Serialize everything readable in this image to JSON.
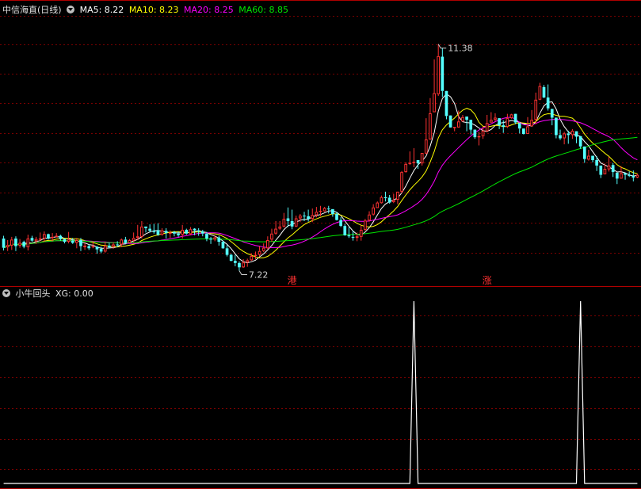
{
  "header_main": {
    "title": "中信海直(日线)",
    "ma5": "MA5: 8.22",
    "ma10": "MA10: 8.23",
    "ma20": "MA20: 8.25",
    "ma60": "MA60: 8.85"
  },
  "header_ind": {
    "title": "小牛回头",
    "xg": "XG: 0.00"
  },
  "colors": {
    "up": "#ff3232",
    "down": "#54ffff",
    "ma5": "#ffffff",
    "ma10": "#ffff00",
    "ma20": "#ff00ff",
    "ma60": "#00e600",
    "grid": "#7a0000",
    "marker_text": "#ff3232",
    "xg_line": "#ffffff"
  },
  "chart_data": [
    {
      "type": "candlestick",
      "ylim": [
        6.95,
        11.9
      ],
      "annotations": {
        "high_label": "11.38",
        "low_label": "7.22"
      },
      "markers": [
        {
          "index": 71,
          "label": "港"
        },
        {
          "index": 119,
          "label": "涨"
        },
        {
          "index": 159,
          "label": "$"
        }
      ],
      "series_names": [
        "MA5",
        "MA10",
        "MA20",
        "MA60"
      ],
      "candles": [
        [
          7.81,
          7.64,
          7.86,
          7.59
        ],
        [
          7.65,
          7.69,
          7.78,
          7.58
        ],
        [
          7.68,
          7.79,
          7.84,
          7.6
        ],
        [
          7.81,
          7.67,
          7.85,
          7.58
        ],
        [
          7.68,
          7.73,
          7.8,
          7.64
        ],
        [
          7.75,
          7.66,
          7.77,
          7.63
        ],
        [
          7.65,
          7.81,
          7.88,
          7.59
        ],
        [
          7.82,
          7.77,
          7.86,
          7.75
        ],
        [
          7.76,
          7.8,
          7.84,
          7.71
        ],
        [
          7.81,
          7.81,
          7.92,
          7.76
        ],
        [
          7.81,
          7.89,
          7.94,
          7.75
        ],
        [
          7.89,
          7.81,
          7.9,
          7.79
        ],
        [
          7.82,
          7.84,
          7.91,
          7.76
        ],
        [
          7.85,
          7.86,
          7.91,
          7.83
        ],
        [
          7.86,
          7.8,
          7.88,
          7.77
        ],
        [
          7.8,
          7.75,
          7.81,
          7.72
        ],
        [
          7.75,
          7.79,
          7.93,
          7.72
        ],
        [
          7.77,
          7.73,
          7.82,
          7.71
        ],
        [
          7.73,
          7.78,
          7.82,
          7.63
        ],
        [
          7.78,
          7.67,
          7.82,
          7.58
        ],
        [
          7.65,
          7.68,
          7.73,
          7.6
        ],
        [
          7.67,
          7.63,
          7.7,
          7.6
        ],
        [
          7.65,
          7.67,
          7.76,
          7.63
        ],
        [
          7.66,
          7.61,
          7.67,
          7.53
        ],
        [
          7.62,
          7.57,
          7.66,
          7.54
        ],
        [
          7.57,
          7.68,
          7.75,
          7.55
        ],
        [
          7.68,
          7.65,
          7.73,
          7.63
        ],
        [
          7.66,
          7.7,
          7.74,
          7.62
        ],
        [
          7.7,
          7.69,
          7.76,
          7.65
        ],
        [
          7.7,
          7.79,
          7.81,
          7.65
        ],
        [
          7.79,
          7.73,
          7.84,
          7.71
        ],
        [
          7.73,
          7.78,
          7.8,
          7.73
        ],
        [
          7.77,
          7.82,
          7.92,
          7.74
        ],
        [
          7.82,
          7.85,
          8.06,
          7.78
        ],
        [
          7.84,
          8.03,
          8.13,
          7.81
        ],
        [
          8.03,
          8.0,
          8.03,
          7.92
        ],
        [
          7.99,
          7.95,
          8.07,
          7.92
        ],
        [
          7.95,
          7.93,
          8.08,
          7.9
        ],
        [
          7.96,
          7.88,
          8.09,
          7.86
        ],
        [
          7.88,
          7.96,
          8.0,
          7.86
        ],
        [
          7.95,
          7.91,
          8.0,
          7.81
        ],
        [
          7.91,
          7.92,
          7.96,
          7.82
        ],
        [
          7.93,
          7.9,
          7.95,
          7.85
        ],
        [
          7.9,
          7.87,
          7.94,
          7.84
        ],
        [
          7.88,
          7.97,
          8.06,
          7.81
        ],
        [
          7.97,
          7.9,
          7.99,
          7.88
        ],
        [
          7.89,
          7.98,
          8.02,
          7.87
        ],
        [
          7.99,
          7.96,
          8.0,
          7.87
        ],
        [
          7.96,
          7.94,
          8.0,
          7.86
        ],
        [
          7.94,
          7.9,
          7.97,
          7.85
        ],
        [
          7.9,
          7.81,
          7.93,
          7.76
        ],
        [
          7.81,
          7.79,
          7.84,
          7.71
        ],
        [
          7.79,
          7.83,
          7.87,
          7.76
        ],
        [
          7.83,
          7.75,
          7.86,
          7.68
        ],
        [
          7.75,
          7.63,
          7.77,
          7.62
        ],
        [
          7.63,
          7.51,
          7.69,
          7.48
        ],
        [
          7.51,
          7.4,
          7.53,
          7.39
        ],
        [
          7.4,
          7.36,
          7.51,
          7.3
        ],
        [
          7.36,
          7.28,
          7.39,
          7.22
        ],
        [
          7.28,
          7.37,
          7.43,
          7.27
        ],
        [
          7.37,
          7.41,
          7.44,
          7.29
        ],
        [
          7.41,
          7.49,
          7.54,
          7.4
        ],
        [
          7.5,
          7.51,
          7.57,
          7.43
        ],
        [
          7.51,
          7.58,
          7.67,
          7.48
        ],
        [
          7.58,
          7.64,
          7.72,
          7.56
        ],
        [
          7.63,
          7.78,
          7.85,
          7.61
        ],
        [
          7.79,
          7.9,
          7.99,
          7.75
        ],
        [
          7.9,
          7.99,
          8.13,
          7.88
        ],
        [
          7.99,
          8.03,
          8.13,
          7.97
        ],
        [
          8.03,
          8.17,
          8.28,
          8.01
        ],
        [
          8.18,
          8.13,
          8.38,
          8.02
        ],
        [
          8.13,
          8.03,
          8.34,
          7.98
        ],
        [
          8.03,
          8.18,
          8.23,
          8.02
        ],
        [
          8.18,
          8.23,
          8.26,
          8.11
        ],
        [
          8.23,
          8.22,
          8.3,
          8.13
        ],
        [
          8.22,
          8.17,
          8.34,
          8.12
        ],
        [
          8.17,
          8.24,
          8.36,
          8.11
        ],
        [
          8.24,
          8.3,
          8.39,
          8.2
        ],
        [
          8.31,
          8.32,
          8.41,
          8.22
        ],
        [
          8.31,
          8.37,
          8.39,
          8.3
        ],
        [
          8.36,
          8.35,
          8.41,
          8.27
        ],
        [
          8.35,
          8.26,
          8.35,
          8.21
        ],
        [
          8.26,
          8.15,
          8.3,
          8.14
        ],
        [
          8.15,
          8.04,
          8.2,
          8.02
        ],
        [
          8.04,
          7.87,
          8.08,
          7.86
        ],
        [
          7.87,
          7.85,
          8.02,
          7.82
        ],
        [
          7.84,
          7.83,
          7.95,
          7.77
        ],
        [
          7.82,
          7.85,
          7.92,
          7.76
        ],
        [
          7.84,
          7.97,
          8.05,
          7.77
        ],
        [
          7.97,
          8.14,
          8.17,
          7.95
        ],
        [
          8.14,
          8.25,
          8.31,
          8.12
        ],
        [
          8.25,
          8.38,
          8.44,
          8.23
        ],
        [
          8.37,
          8.47,
          8.49,
          8.37
        ],
        [
          8.46,
          8.57,
          8.6,
          8.45
        ],
        [
          8.57,
          8.55,
          8.67,
          8.49
        ],
        [
          8.56,
          8.47,
          8.61,
          8.45
        ],
        [
          8.48,
          8.52,
          8.63,
          8.46
        ],
        [
          8.52,
          8.67,
          8.67,
          8.44
        ],
        [
          8.67,
          9.03,
          9.05,
          8.64
        ],
        [
          9.03,
          9.18,
          9.21,
          9.02
        ],
        [
          9.19,
          9.2,
          9.41,
          9.16
        ],
        [
          9.22,
          9.22,
          9.47,
          9.12
        ],
        [
          9.25,
          9.19,
          9.23,
          9.09
        ],
        [
          9.19,
          9.38,
          9.37,
          9.15
        ],
        [
          9.37,
          9.63,
          10.02,
          9.61
        ],
        [
          9.63,
          10.11,
          10.39,
          9.64
        ],
        [
          10.13,
          10.48,
          11.1,
          10.37
        ],
        [
          10.46,
          11.16,
          11.38,
          10.43
        ],
        [
          11.15,
          10.52,
          11.31,
          10.41
        ],
        [
          10.52,
          10.06,
          10.31,
          10.0
        ],
        [
          10.07,
          9.85,
          10.01,
          9.9
        ],
        [
          9.84,
          9.86,
          9.86,
          9.78
        ],
        [
          9.85,
          9.96,
          10.16,
          9.9
        ],
        [
          9.96,
          10.04,
          10.08,
          9.97
        ],
        [
          10.05,
          9.99,
          10.03,
          9.78
        ],
        [
          9.99,
          9.81,
          9.79,
          9.72
        ],
        [
          9.81,
          9.67,
          9.71,
          9.64
        ],
        [
          9.67,
          9.69,
          9.77,
          9.52
        ],
        [
          9.69,
          9.79,
          9.87,
          9.64
        ],
        [
          9.78,
          9.93,
          10.08,
          9.76
        ],
        [
          9.94,
          9.99,
          10.13,
          9.96
        ],
        [
          9.99,
          10.03,
          10.11,
          9.96
        ],
        [
          10.02,
          9.89,
          10.01,
          9.82
        ],
        [
          9.89,
          9.86,
          9.98,
          9.75
        ],
        [
          9.86,
          10.02,
          10.1,
          9.84
        ],
        [
          10.02,
          10.09,
          10.1,
          10.01
        ],
        [
          10.1,
          9.94,
          10.01,
          9.91
        ],
        [
          9.93,
          9.83,
          9.9,
          9.74
        ],
        [
          9.83,
          9.73,
          9.8,
          9.72
        ],
        [
          9.73,
          9.87,
          10.04,
          9.74
        ],
        [
          9.87,
          9.99,
          10.17,
          9.96
        ],
        [
          9.99,
          10.36,
          10.49,
          9.91
        ],
        [
          10.36,
          10.61,
          10.67,
          10.35
        ],
        [
          10.59,
          10.4,
          10.63,
          10.39
        ],
        [
          10.4,
          10.2,
          10.64,
          10.16
        ],
        [
          10.19,
          10.03,
          10.16,
          9.89
        ],
        [
          10.03,
          9.71,
          9.91,
          9.65
        ],
        [
          9.71,
          9.65,
          9.81,
          9.62
        ],
        [
          9.65,
          9.74,
          9.77,
          9.54
        ],
        [
          9.74,
          9.71,
          9.79,
          9.55
        ],
        [
          9.71,
          9.79,
          9.82,
          9.64
        ],
        [
          9.78,
          9.68,
          9.73,
          9.56
        ],
        [
          9.69,
          9.5,
          9.59,
          9.46
        ],
        [
          9.5,
          9.27,
          9.3,
          9.2
        ],
        [
          9.26,
          9.33,
          9.44,
          9.24
        ],
        [
          9.33,
          9.25,
          9.33,
          9.21
        ],
        [
          9.25,
          9.15,
          9.32,
          9.05
        ],
        [
          9.15,
          8.98,
          9.09,
          8.92
        ],
        [
          8.99,
          9.09,
          9.19,
          9.04
        ],
        [
          9.08,
          9.15,
          9.31,
          9.04
        ],
        [
          9.16,
          9.03,
          9.2,
          8.94
        ],
        [
          9.02,
          8.91,
          9.0,
          8.81
        ],
        [
          8.91,
          9.01,
          9.14,
          8.93
        ],
        [
          9.01,
          8.98,
          9.0,
          8.89
        ],
        [
          8.98,
          8.96,
          9.04,
          8.94
        ],
        [
          8.96,
          8.93,
          9.06,
          8.86
        ],
        [
          8.93,
          8.98,
          9.0,
          8.92
        ]
      ]
    },
    {
      "type": "line",
      "name": "XG",
      "ylim": [
        0,
        1
      ],
      "spikes_at": [
        101,
        142
      ],
      "value_label": "XG: 0.00"
    }
  ]
}
